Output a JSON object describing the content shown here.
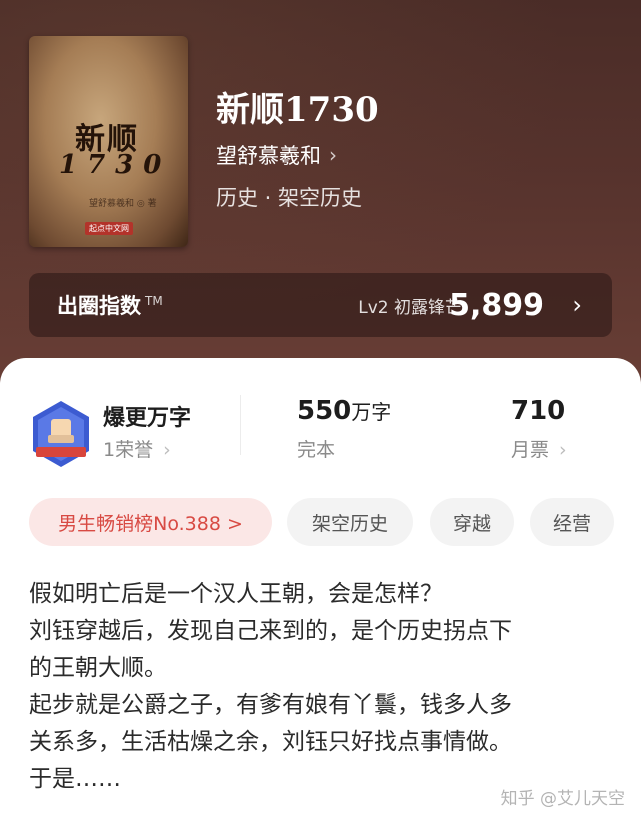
{
  "book": {
    "title": "新顺1730",
    "author": "望舒慕羲和",
    "genre": "历史 · 架空历史",
    "cover": {
      "title": "新顺",
      "year": "1730",
      "author": "望舒慕羲和 ◎ 著",
      "publisher": "起点中文网"
    }
  },
  "index_bar": {
    "label": "出圈指数",
    "tm": "TM",
    "level": "Lv2 初露锋芒",
    "value": "5,899"
  },
  "stats": {
    "badge": {
      "title": "爆更万字",
      "sub": "1荣誉"
    },
    "words": {
      "number": "550",
      "unit": "万字",
      "sub": "完本"
    },
    "votes": {
      "number": "710",
      "sub": "月票"
    }
  },
  "tags": [
    {
      "label": "男生畅销榜No.388 >"
    },
    {
      "label": "架空历史"
    },
    {
      "label": "穿越"
    },
    {
      "label": "经营"
    }
  ],
  "description": [
    "假如明亡后是一个汉人王朝，会是怎样？",
    "刘钰穿越后，发现自己来到的，是个历史拐点下",
    "的王朝大顺。",
    "起步就是公爵之子，有爹有娘有丫鬟，钱多人多",
    "关系多，生活枯燥之余，刘钰只好找点事情做。",
    "于是……"
  ],
  "watermark": "知乎 @艾儿天空",
  "colors": {
    "hero_bg": "#57332d",
    "accent_red": "#d84a43",
    "tag_bg": "#f3f3f3"
  }
}
